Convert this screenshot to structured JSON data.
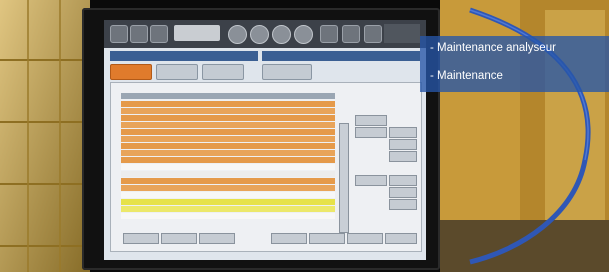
{
  "overlay": {
    "lines": [
      "- Maintenance analyseur",
      "- Maintenance"
    ],
    "background": "#2656a8",
    "text_color": "#ffffff"
  },
  "monitor_screen": {
    "accent_row_color": "#e59a4a",
    "highlight_row_color": "#e6e24a",
    "header_bar_color": "#3b5f93",
    "active_tab_color": "#e07b2c"
  },
  "icons": [
    "monitor-icon",
    "print-icon",
    "help-icon",
    "arrow-icon"
  ]
}
